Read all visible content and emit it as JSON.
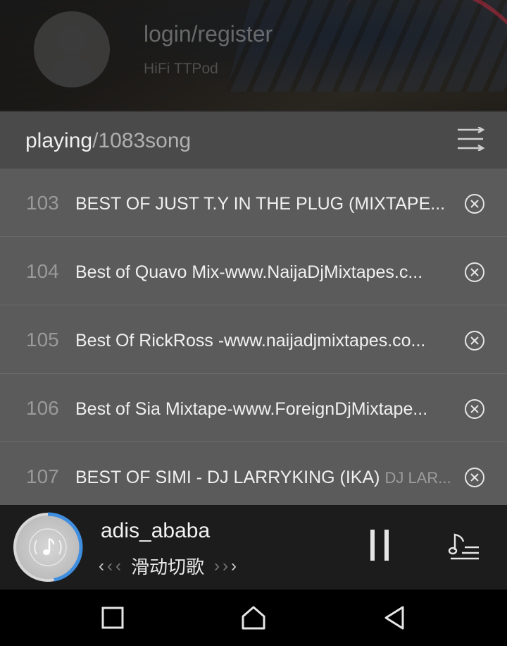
{
  "header": {
    "login_title": "login/register",
    "login_subtitle": "HiFi TTPod",
    "icons": {
      "avatar": "user-avatar-icon"
    }
  },
  "playlist": {
    "playing_label": "playing",
    "count_label": "/1083song",
    "sort_icon": "sort-lines-icon",
    "rows": [
      {
        "num": "103",
        "title": "BEST OF JUST T.Y IN THE PLUG (MIXTAPE...",
        "artist": ""
      },
      {
        "num": "104",
        "title": "Best of Quavo Mix-www.NaijaDjMixtapes.c...",
        "artist": ""
      },
      {
        "num": "105",
        "title": "Best Of RickRoss -www.naijadjmixtapes.co...",
        "artist": ""
      },
      {
        "num": "106",
        "title": "Best of Sia Mixtape-www.ForeignDjMixtape...",
        "artist": ""
      },
      {
        "num": "107",
        "title": "BEST OF SIMI - DJ LARRYKING (IKA) ",
        "artist": "DJ LAR..."
      }
    ]
  },
  "player": {
    "track_name": "adis_ababa",
    "swipe_label": "滑动切歌",
    "progress_fraction": 0.47,
    "colors": {
      "progress": "#3f8ee0",
      "ring_base": "#d8d8d8"
    },
    "icons": {
      "disc": "music-note-icon",
      "pause": "pause-icon",
      "lyrics": "music-list-icon"
    }
  },
  "navbar": {
    "icons": [
      "recent-apps-icon",
      "home-icon",
      "back-icon"
    ]
  }
}
